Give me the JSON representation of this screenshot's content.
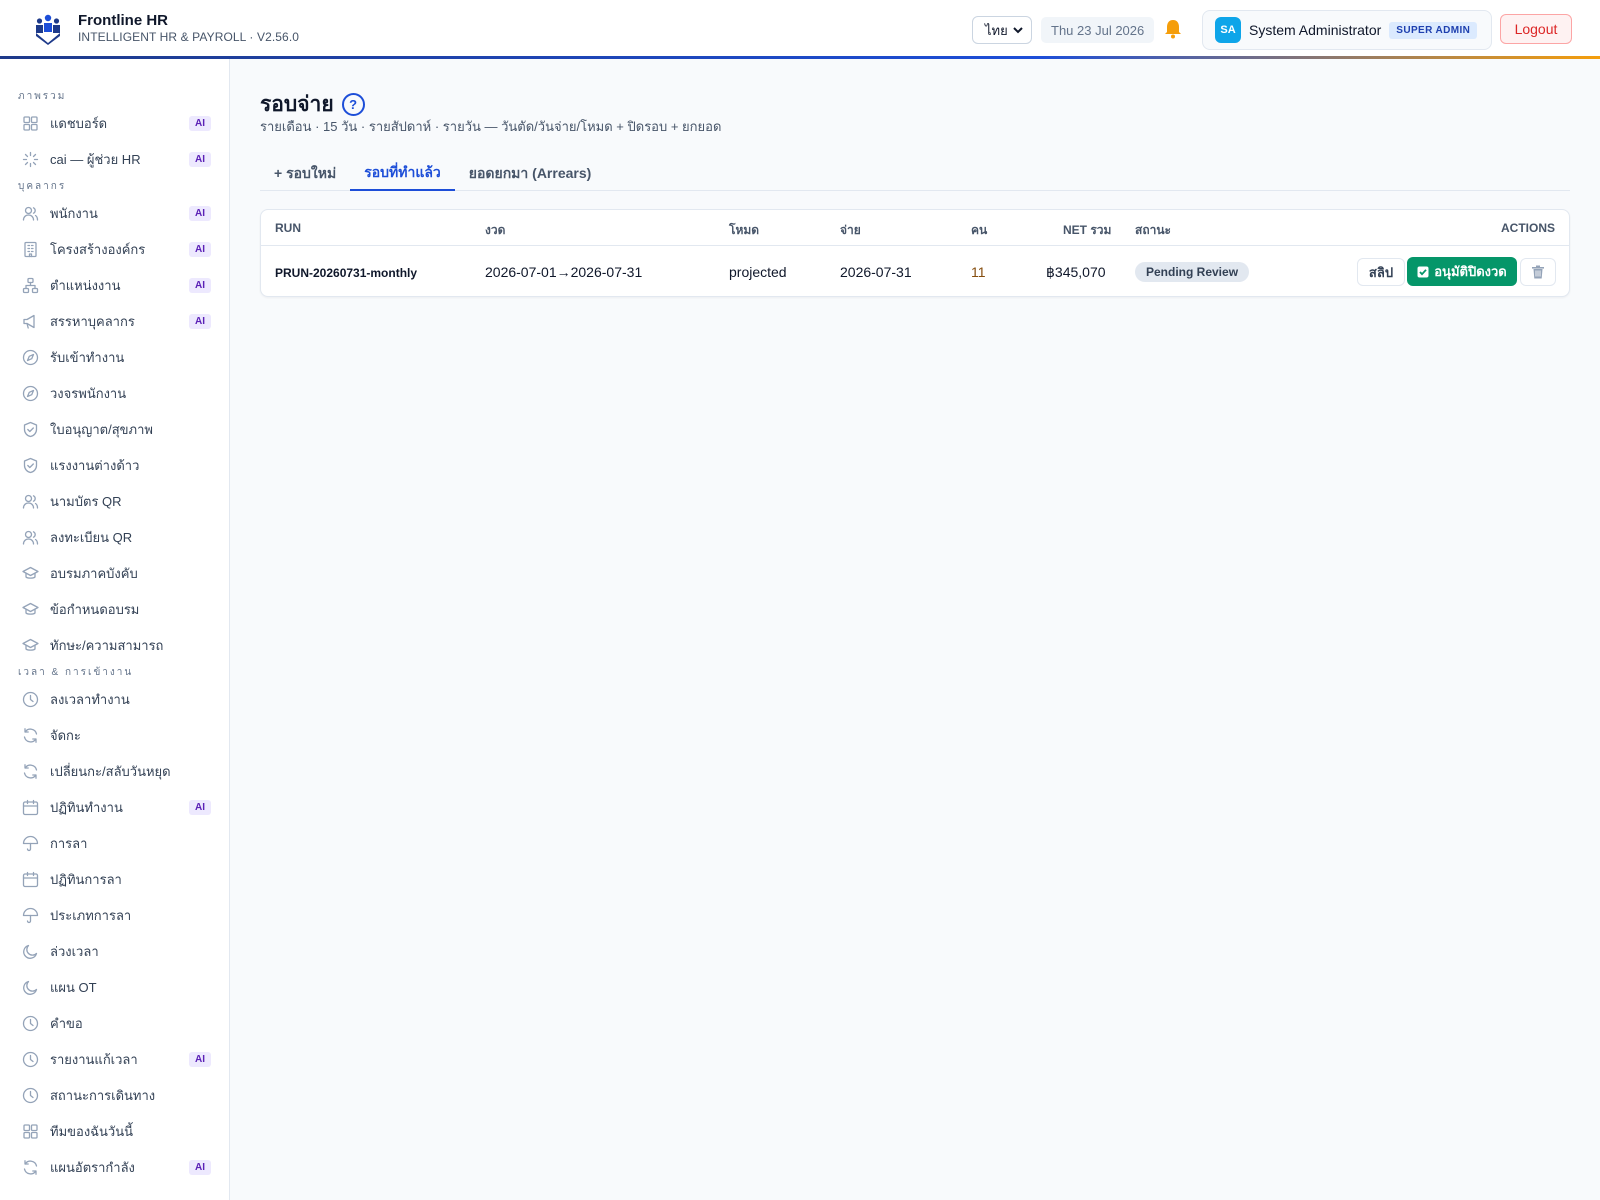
{
  "app": {
    "title": "Frontline HR",
    "subtitle": "INTELLIGENT HR & PAYROLL · V2.56.0"
  },
  "header": {
    "language": "ไทย",
    "date": "Thu 23 Jul 2026",
    "user_initials": "SA",
    "user_name": "System Administrator",
    "role": "SUPER ADMIN",
    "logout": "Logout"
  },
  "sidebar": {
    "sections": [
      {
        "title": "ภาพรวม",
        "items": [
          {
            "label": "แดชบอร์ด",
            "icon": "grid-icon",
            "ai": "AI"
          },
          {
            "label": "cai — ผู้ช่วย HR",
            "icon": "sparkle-icon",
            "ai": "AI"
          }
        ]
      },
      {
        "title": "บุคลากร",
        "items": [
          {
            "label": "พนักงาน",
            "icon": "users-icon",
            "ai": "AI"
          },
          {
            "label": "โครงสร้างองค์กร",
            "icon": "building-icon",
            "ai": "AI"
          },
          {
            "label": "ตำแหน่งงาน",
            "icon": "org-chart-icon",
            "ai": "AI"
          },
          {
            "label": "สรรหาบุคลากร",
            "icon": "megaphone-icon",
            "ai": "AI"
          },
          {
            "label": "รับเข้าทำงาน",
            "icon": "compass-icon"
          },
          {
            "label": "วงจรพนักงาน",
            "icon": "compass-icon"
          },
          {
            "label": "ใบอนุญาต/สุขภาพ",
            "icon": "shield-icon"
          },
          {
            "label": "แรงงานต่างด้าว",
            "icon": "shield-icon"
          },
          {
            "label": "นามบัตร QR",
            "icon": "users-icon"
          },
          {
            "label": "ลงทะเบียน QR",
            "icon": "users-icon"
          },
          {
            "label": "อบรมภาคบังคับ",
            "icon": "graduation-cap-icon"
          },
          {
            "label": "ข้อกำหนดอบรม",
            "icon": "graduation-cap-icon"
          },
          {
            "label": "ทักษะ/ความสามารถ",
            "icon": "graduation-cap-icon"
          }
        ]
      },
      {
        "title": "เวลา & การเข้างาน",
        "items": [
          {
            "label": "ลงเวลาทำงาน",
            "icon": "clock-icon"
          },
          {
            "label": "จัดกะ",
            "icon": "refresh-icon"
          },
          {
            "label": "เปลี่ยนกะ/สลับวันหยุด",
            "icon": "refresh-icon"
          },
          {
            "label": "ปฏิทินทำงาน",
            "icon": "calendar-icon",
            "ai": "AI"
          },
          {
            "label": "การลา",
            "icon": "umbrella-icon"
          },
          {
            "label": "ปฏิทินการลา",
            "icon": "calendar-icon"
          },
          {
            "label": "ประเภทการลา",
            "icon": "umbrella-icon"
          },
          {
            "label": "ล่วงเวลา",
            "icon": "moon-icon"
          },
          {
            "label": "แผน OT",
            "icon": "moon-icon"
          },
          {
            "label": "คำขอ",
            "icon": "clock-icon"
          },
          {
            "label": "รายงานแก้เวลา",
            "icon": "clock-icon",
            "ai": "AI"
          },
          {
            "label": "สถานะการเดินทาง",
            "icon": "clock-icon"
          },
          {
            "label": "ทีมของฉันวันนี้",
            "icon": "grid-icon"
          },
          {
            "label": "แผนอัตรากำลัง",
            "icon": "refresh-icon",
            "ai": "AI"
          }
        ]
      }
    ]
  },
  "page": {
    "title": "รอบจ่าย",
    "help": "?",
    "subtitle": "รายเดือน · 15 วัน · รายสัปดาห์ · รายวัน — วันตัด/วันจ่าย/โหมด + ปิดรอบ + ยกยอด",
    "tabs": [
      "+ รอบใหม่",
      "รอบที่ทำแล้ว",
      "ยอดยกมา (Arrears)"
    ],
    "active_tab": 1
  },
  "table": {
    "headers": {
      "run": "RUN",
      "period": "งวด",
      "mode": "โหมด",
      "pay": "จ่าย",
      "people": "คน",
      "net": "NET รวม",
      "status": "สถานะ",
      "actions": "ACTIONS"
    },
    "rows": [
      {
        "run": "PRUN-20260731-monthly",
        "period": "2026-07-01→2026-07-31",
        "mode": "projected",
        "pay": "2026-07-31",
        "people": "11",
        "net": "฿345,070",
        "status": "Pending Review",
        "slip": "สลิป",
        "approve": "อนุมัติปิดงวด"
      }
    ]
  },
  "colors": {
    "accent": "#1d4ed8",
    "approve": "#059669",
    "logout": "#dc2626",
    "ai_badge": "#ede9fe"
  }
}
